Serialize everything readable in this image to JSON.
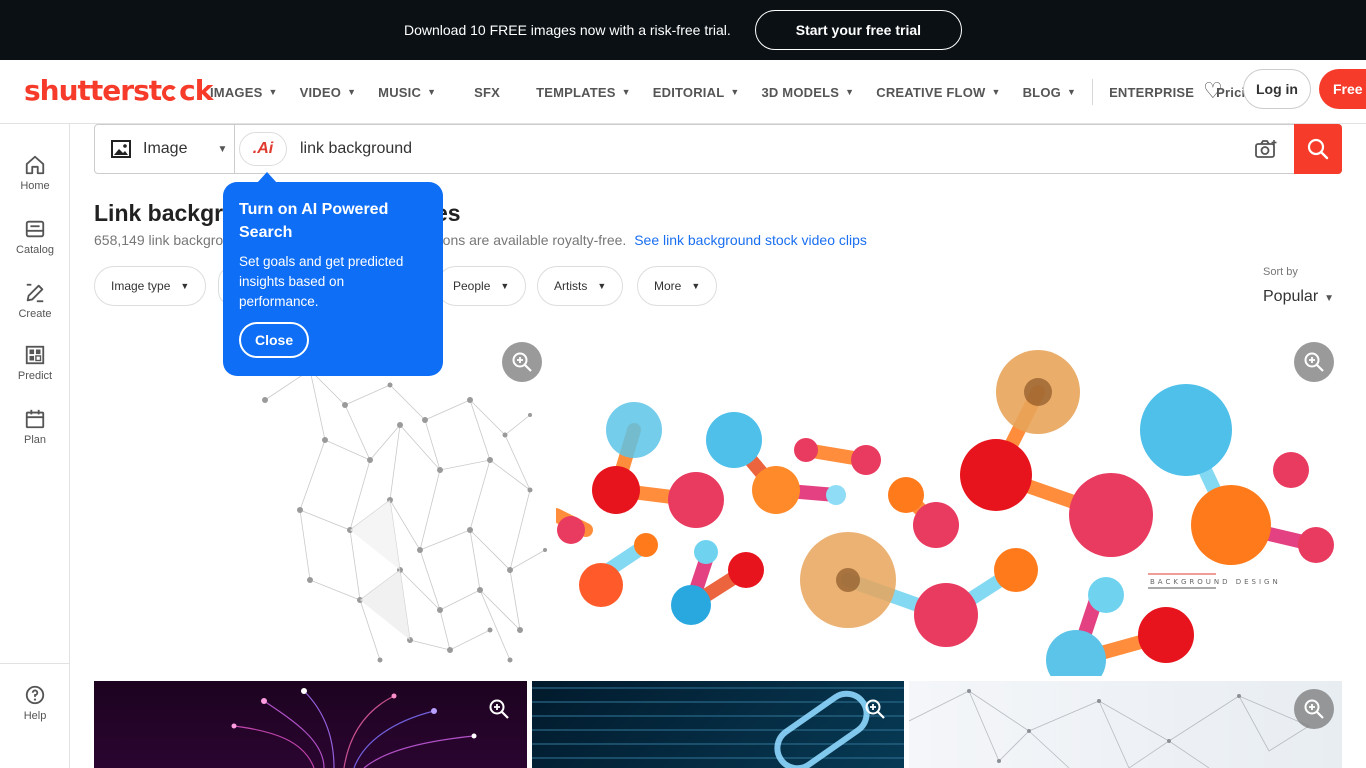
{
  "promo": {
    "text": "Download 10 FREE images now with a risk-free trial.",
    "cta": "Start your free trial"
  },
  "logo": {
    "part1": "shutterst",
    "part2": "ck"
  },
  "nav": {
    "items": [
      "IMAGES",
      "VIDEO",
      "MUSIC",
      "SFX",
      "TEMPLATES",
      "EDITORIAL",
      "3D MODELS",
      "CREATIVE FLOW",
      "BLOG"
    ],
    "enterprise": "ENTERPRISE",
    "pricing": "Pricing",
    "login": "Log in",
    "free": "Free t"
  },
  "sidebar": {
    "home": "Home",
    "catalog": "Catalog",
    "create": "Create",
    "predict": "Predict",
    "plan": "Plan",
    "help": "Help"
  },
  "search": {
    "type": "Image",
    "ai_label": ".Ai",
    "query": "link background"
  },
  "title": {
    "part1": "Link backgr",
    "part2": "ages"
  },
  "subtitle": {
    "part1": "658,149 link backgro",
    "part2": "rations are available royalty-free.",
    "link": "See link background stock video clips"
  },
  "filters": {
    "image_type": "Image type",
    "people": "People",
    "artists": "Artists",
    "more": "More"
  },
  "sort": {
    "label": "Sort by",
    "value": "Popular"
  },
  "tooltip": {
    "title": "Turn on AI Powered Search",
    "body": "Set goals and get predicted insights based on performance.",
    "close": "Close"
  },
  "image_text": {
    "caption": "BACKGROUND  DESIGN"
  },
  "colors": {
    "brand": "#f63b2a",
    "accent": "#0e6ef5",
    "promo_bg": "#0b1014"
  }
}
